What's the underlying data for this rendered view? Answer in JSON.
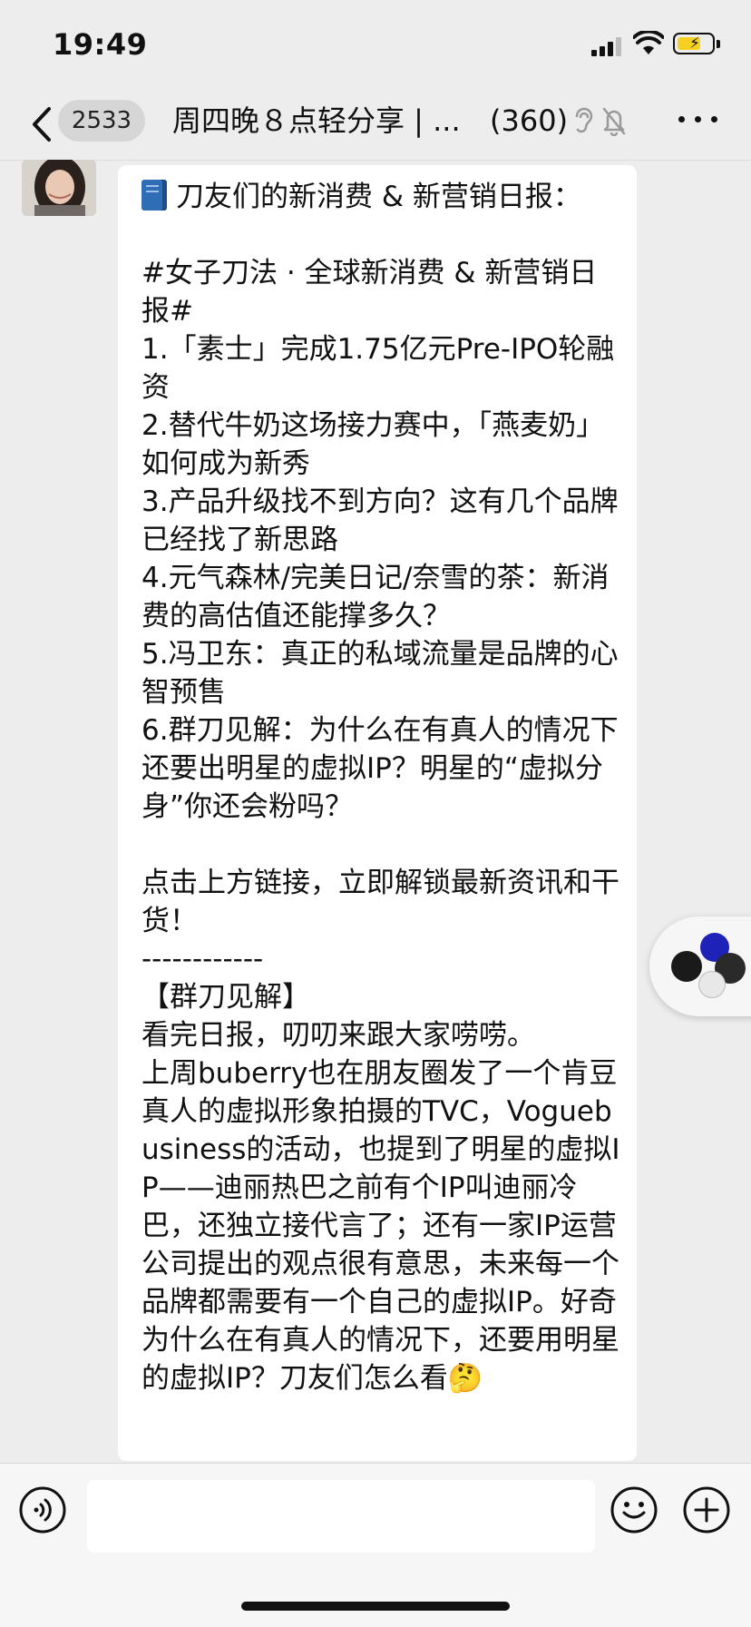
{
  "status_bar": {
    "time": "19:49",
    "battery_state": "charging"
  },
  "nav": {
    "back_badge": "2533",
    "title": "周四晚８点轻分享 | ...",
    "member_count": "(360)",
    "icons": [
      "back-chevron-icon",
      "ear-icon",
      "mute-bell-icon",
      "more-icon"
    ]
  },
  "message": {
    "text": "刀友们的新消费 & 新营销日报：\n\n#女子刀法 · 全球新消费 & 新营销日报#\n1.「素士」完成1.75亿元Pre-IPO轮融资\n2.替代牛奶这场接力赛中，「燕麦奶」如何成为新秀\n3.产品升级找不到方向？这有几个品牌已经找了新思路\n4.元气森林/完美日记/奈雪的茶：新消费的高估值还能撑多久？\n5.冯卫东：真正的私域流量是品牌的心智预售\n6.群刀见解：为什么在有真人的情况下还要出明星的虚拟IP？明星的“虚拟分身”你还会粉吗？\n\n点击上方链接，立即解锁最新资讯和干货！\n------------\n【群刀见解】\n看完日报，叨叨来跟大家唠唠。\n上周buberry也在朋友圈发了一个肯豆真人的虚拟形象拍摄的TVC，Voguebusiness的活动，也提到了明星的虚拟IP——迪丽热巴之前有个IP叫迪丽冷巴，还独立接代言了；还有一家IP运营公司提出的观点很有意思，未来每一个品牌都需要有一个自己的虚拟IP。好奇为什么在有真人的情况下，还要用明星的虚拟IP？刀友们怎么看🤔",
    "leading_icon": "book-icon"
  },
  "input_bar": {
    "icons": [
      "voice-icon",
      "emoji-icon",
      "plus-icon"
    ],
    "input_value": ""
  }
}
